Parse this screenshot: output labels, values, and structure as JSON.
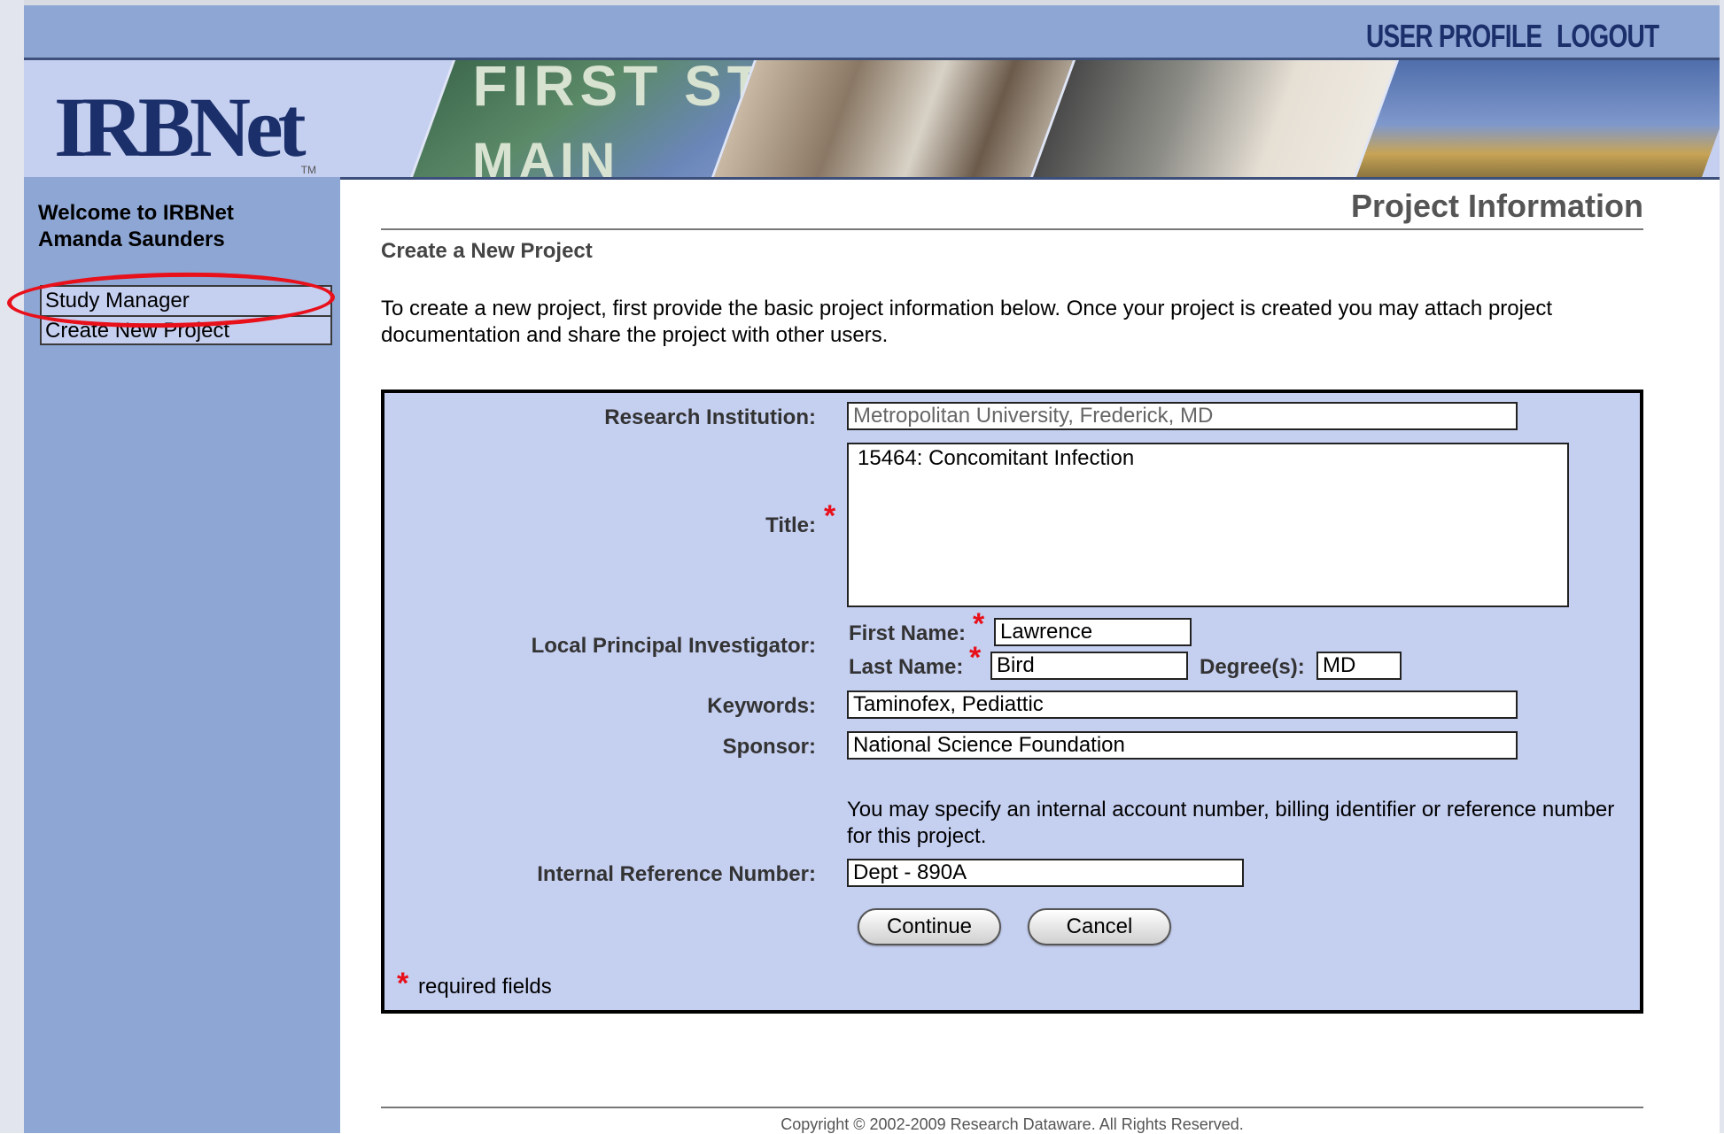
{
  "header": {
    "user_profile": "USER PROFILE",
    "logout": "LOGOUT",
    "logo": "IRBNet",
    "logo_tm": "TM",
    "sign_text": "FIRST ST",
    "sign_text2": "MAIN"
  },
  "sidebar": {
    "welcome_line1": "Welcome to IRBNet",
    "welcome_line2": "Amanda Saunders",
    "items": [
      {
        "label": "Study Manager"
      },
      {
        "label": "Create New Project"
      }
    ]
  },
  "page": {
    "title": "Project Information",
    "subtitle": "Create a New Project",
    "intro": "To create a new project, first provide the basic project information below. Once your project is created you may attach project documentation and share the project with other users."
  },
  "form": {
    "institution_label": "Research Institution:",
    "institution_value": "Metropolitan University, Frederick, MD",
    "title_label": "Title:",
    "title_value": "15464:  Concomitant Infection",
    "pi_label": "Local Principal Investigator:",
    "first_name_label": "First Name:",
    "first_name_value": "Lawrence",
    "last_name_label": "Last Name:",
    "last_name_value": "Bird",
    "degrees_label": "Degree(s):",
    "degrees_value": "MD",
    "keywords_label": "Keywords:",
    "keywords_value": "Taminofex, Pediattic",
    "sponsor_label": "Sponsor:",
    "sponsor_value": "National Science Foundation",
    "ref_note": "You may specify an internal account number, billing identifier or reference number for this project.",
    "ref_label": "Internal Reference Number:",
    "ref_value": "Dept - 890A",
    "continue_label": "Continue",
    "cancel_label": "Cancel",
    "required_star": "*",
    "required_note": "required fields"
  },
  "footer": {
    "copyright": "Copyright © 2002-2009 Research Dataware. All Rights Reserved."
  },
  "colors": {
    "header_blue": "#8da6d4",
    "panel_lavender": "#c5cff0",
    "navy": "#1b2f6b",
    "required_red": "#e8101a",
    "annotation_red": "#e8101a"
  }
}
